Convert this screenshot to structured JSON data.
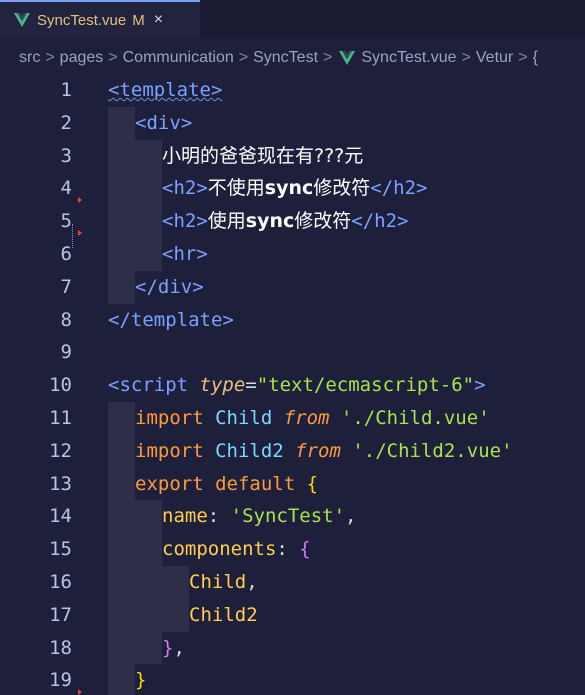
{
  "tab": {
    "file_name": "SyncTest.vue",
    "modified_indicator": "M",
    "close_icon": "×",
    "icon": "vue-icon"
  },
  "breadcrumb": {
    "segments": [
      "src",
      "pages",
      "Communication",
      "SyncTest",
      "SyncTest.vue",
      "Vetur"
    ],
    "separator": ">",
    "trailing": "{"
  },
  "colors": {
    "background": "#1e1f3b",
    "tag": "#7aa2ff",
    "keyword": "#ff9a3c",
    "identifier": "#7bd8ff",
    "property": "#ffcf4d",
    "string": "#a9e34b",
    "attribute": "#e5c07b",
    "chinese": "#ffffff",
    "punctuation": "#d7dae0",
    "brace": "#ffd700",
    "brace2": "#d17cf0",
    "line_number": "#b9c3e6"
  },
  "code": {
    "line_numbers": [
      "1",
      "2",
      "3",
      "4",
      "5",
      "6",
      "7",
      "8",
      "9",
      "10",
      "11",
      "12",
      "13",
      "14",
      "15",
      "16",
      "17",
      "18",
      "19"
    ],
    "lines": [
      [
        {
          "t": "<template>",
          "c": "tag",
          "squiggle": true
        }
      ],
      [
        {
          "t": "<div>",
          "c": "tag"
        }
      ],
      [
        {
          "t": "小明的爸爸现在有???元",
          "c": "chinese"
        }
      ],
      [
        {
          "t": "<h2>",
          "c": "tag"
        },
        {
          "t": "不使用",
          "c": "chinese"
        },
        {
          "t": "sync",
          "c": "chinese",
          "bold": true
        },
        {
          "t": "修改符",
          "c": "chinese"
        },
        {
          "t": "</h2>",
          "c": "tag"
        }
      ],
      [
        {
          "t": "<h2>",
          "c": "tag"
        },
        {
          "t": "使用",
          "c": "chinese"
        },
        {
          "t": "sync",
          "c": "chinese",
          "bold": true
        },
        {
          "t": "修改符",
          "c": "chinese"
        },
        {
          "t": "</h2>",
          "c": "tag"
        }
      ],
      [
        {
          "t": "<hr>",
          "c": "tag"
        }
      ],
      [
        {
          "t": "</div>",
          "c": "tag"
        }
      ],
      [
        {
          "t": "</template>",
          "c": "tag"
        }
      ],
      [],
      [
        {
          "t": "<script ",
          "c": "tag"
        },
        {
          "t": "type",
          "c": "attribute",
          "italic": true
        },
        {
          "t": "=",
          "c": "punctuation"
        },
        {
          "t": "\"text/ecmascript-6\"",
          "c": "string"
        },
        {
          "t": ">",
          "c": "tag"
        }
      ],
      [
        {
          "t": "import ",
          "c": "keyword"
        },
        {
          "t": "Child ",
          "c": "identifier"
        },
        {
          "t": "from ",
          "c": "keyword",
          "italic": true
        },
        {
          "t": "'./Child.vue'",
          "c": "string"
        }
      ],
      [
        {
          "t": "import ",
          "c": "keyword"
        },
        {
          "t": "Child2 ",
          "c": "identifier"
        },
        {
          "t": "from ",
          "c": "keyword",
          "italic": true
        },
        {
          "t": "'./Child2.vue'",
          "c": "string"
        }
      ],
      [
        {
          "t": "export default ",
          "c": "keyword"
        },
        {
          "t": "{",
          "c": "brace"
        }
      ],
      [
        {
          "t": "name",
          "c": "property"
        },
        {
          "t": ": ",
          "c": "punctuation"
        },
        {
          "t": "'SyncTest'",
          "c": "string"
        },
        {
          "t": ",",
          "c": "punctuation"
        }
      ],
      [
        {
          "t": "components",
          "c": "property"
        },
        {
          "t": ": ",
          "c": "punctuation"
        },
        {
          "t": "{",
          "c": "brace2"
        }
      ],
      [
        {
          "t": "Child",
          "c": "property"
        },
        {
          "t": ",",
          "c": "punctuation"
        }
      ],
      [
        {
          "t": "Child2",
          "c": "property"
        }
      ],
      [
        {
          "t": "}",
          "c": "brace2"
        },
        {
          "t": ",",
          "c": "punctuation"
        }
      ],
      [
        {
          "t": "}",
          "c": "brace"
        }
      ]
    ],
    "indents": [
      0,
      1,
      2,
      2,
      2,
      2,
      1,
      0,
      0,
      0,
      1,
      1,
      1,
      2,
      2,
      3,
      3,
      2,
      1
    ],
    "gutter_marks": [
      4,
      5,
      19
    ]
  }
}
